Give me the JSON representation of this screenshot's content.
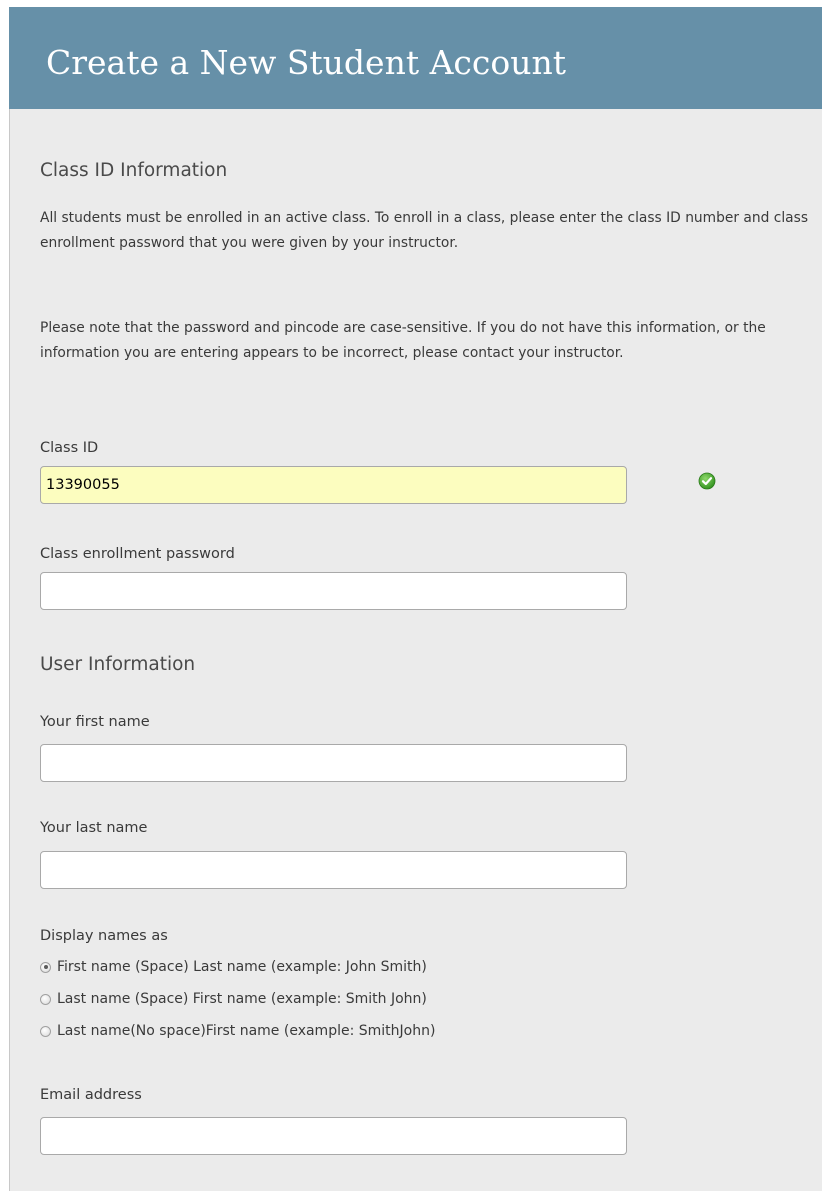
{
  "header": {
    "title": "Create a New Student Account",
    "background_color": "#6690a8"
  },
  "class_section": {
    "title": "Class ID Information",
    "intro": "All students must be enrolled in an active class. To enroll in a class, please enter the class ID number and class enrollment password that you were given by your instructor.",
    "note": "Please note that the password and pincode are case-sensitive. If you do not have this information, or the information you are entering appears to be incorrect, please contact your instructor.",
    "class_id": {
      "label": "Class ID",
      "value": "13390055",
      "status_icon": "valid-check-icon",
      "highlight_color": "#fcfdbf"
    },
    "password": {
      "label": "Class enrollment password",
      "value": ""
    }
  },
  "user_section": {
    "title": "User Information",
    "first_name": {
      "label": "Your first name",
      "value": ""
    },
    "last_name": {
      "label": "Your last name",
      "value": ""
    },
    "display_names": {
      "label": "Display names as",
      "options": [
        {
          "label": "First name (Space) Last name (example: John Smith)",
          "selected": true
        },
        {
          "label": "Last name (Space) First name (example: Smith John)",
          "selected": false
        },
        {
          "label": "Last name(No space)First name (example: SmithJohn)",
          "selected": false
        }
      ]
    },
    "email": {
      "label": "Email address",
      "value": ""
    }
  }
}
